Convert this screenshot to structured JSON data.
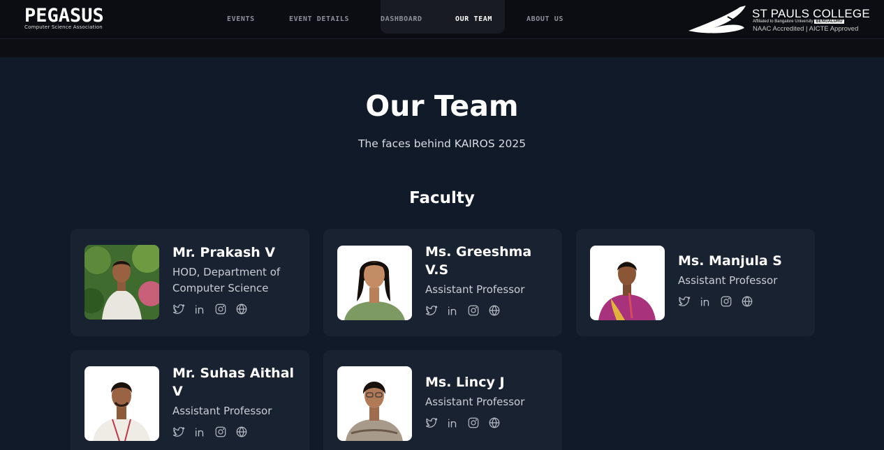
{
  "nav": {
    "brand": "PEGASUS",
    "brand_sub": "Computer Science Association",
    "links": [
      "EVENTS",
      "EVENT DETAILS",
      "DASHBOARD",
      "OUR TEAM",
      "ABOUT US"
    ],
    "active": "OUR TEAM",
    "college_name": "ST PAULS COLLEGE",
    "college_affiliation": "Affiliated to Bangalore University",
    "college_city": "BENGALURU",
    "college_accreditation": "NAAC Accredited | AICTE Approved"
  },
  "hero": {
    "title": "Our Team",
    "subtitle": "The faces behind KAIROS 2025"
  },
  "faculty": {
    "title": "Faculty",
    "members": [
      {
        "name": "Mr. Prakash V",
        "role": "HOD, Department of Computer Science"
      },
      {
        "name": "Ms. Greeshma V.S",
        "role": "Assistant Professor"
      },
      {
        "name": "Ms. Manjula S",
        "role": "Assistant Professor"
      },
      {
        "name": "Mr. Suhas Aithal V",
        "role": "Assistant Professor"
      },
      {
        "name": "Ms. Lincy J",
        "role": "Assistant Professor"
      }
    ]
  },
  "icons": [
    "twitter-icon",
    "linkedin-icon",
    "instagram-icon",
    "globe-icon"
  ],
  "colors": {
    "background": "#111a28",
    "card": "#192231",
    "navbar": "#0c0d13",
    "muted_text": "#c9ced6"
  }
}
